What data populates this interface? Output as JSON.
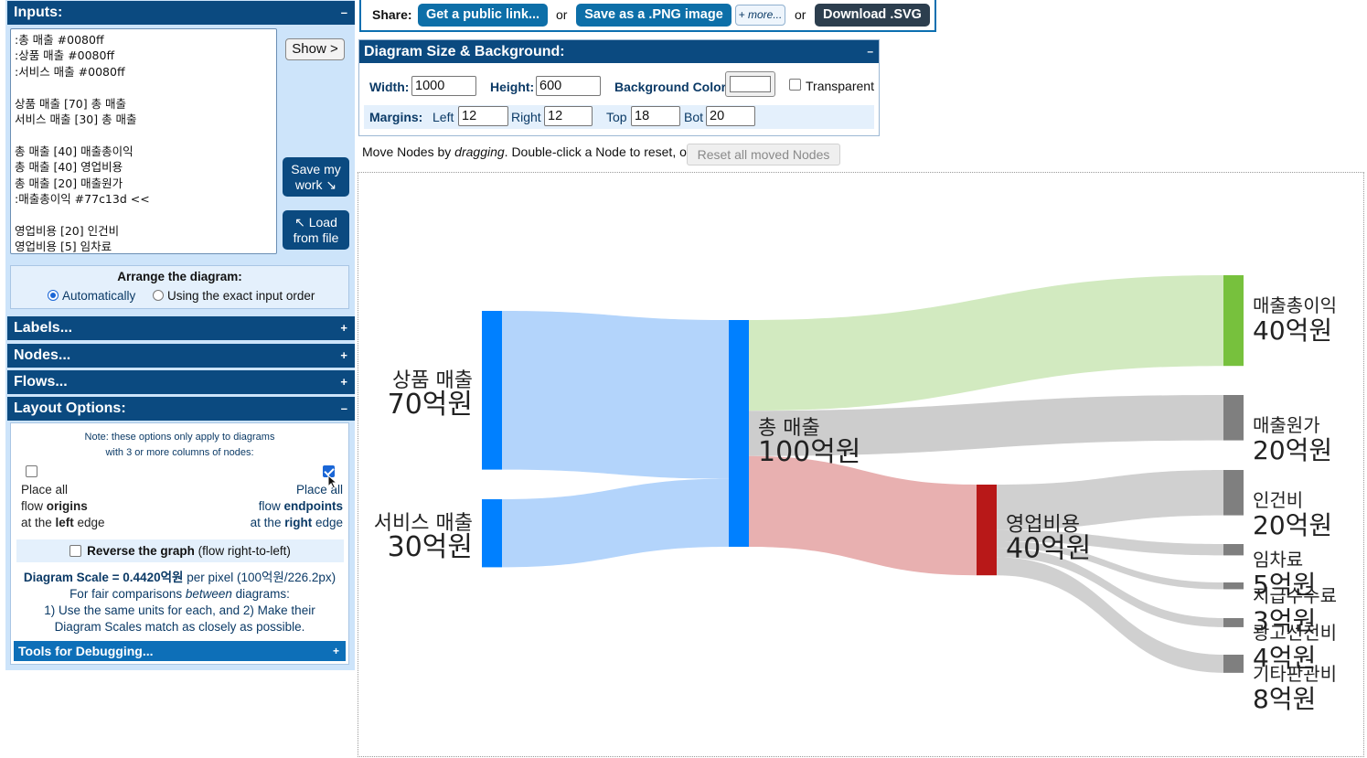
{
  "left_panel": {
    "inputs": {
      "title": "Inputs:",
      "toggle": "–",
      "text": ":총 매출 #0080ff\n:상품 매출 #0080ff\n:서비스 매출 #0080ff\n\n상품 매출 [70] 총 매출\n서비스 매출 [30] 총 매출\n\n총 매출 [40] 매출총이익\n총 매출 [40] 영업비용\n총 매출 [20] 매출원가\n:매출총이익 #77c13d <<\n\n영업비용 [20] 인건비\n영업비용 [5] 임차료",
      "show_label": "Show >",
      "save_label": "Save my work ↘",
      "load_label": "↖ Load from file"
    },
    "arrange": {
      "title": "Arrange the diagram:",
      "option_auto": "Automatically",
      "option_exact": "Using the exact input order",
      "selected": "Automatically"
    },
    "sections": [
      {
        "title": "Labels...",
        "toggle": "+"
      },
      {
        "title": "Nodes...",
        "toggle": "+"
      },
      {
        "title": "Flows...",
        "toggle": "+"
      }
    ],
    "layout_options": {
      "title": "Layout Options:",
      "toggle": "–",
      "note_line1": "Note: these options only apply to diagrams",
      "note_line2": "with 3 or more columns of nodes:",
      "left_opt": {
        "line1": "Place all",
        "line2a": "flow ",
        "line2b": "origins",
        "line3a": "at the ",
        "line3b": "left",
        "line3c": " edge",
        "checked": false
      },
      "right_opt": {
        "line1": "Place all",
        "line2a": "flow ",
        "line2b": "endpoints",
        "line3a": "at the ",
        "line3b": "right",
        "line3c": " edge",
        "checked": true
      },
      "reverse_bold": "Reverse the graph",
      "reverse_rest": " (flow right-to-left)",
      "scale_bold": "Diagram Scale = 0.4420억원",
      "scale_rest": " per pixel (100억원/226.2px)",
      "fair_line_a": "For fair comparisons ",
      "fair_line_em": "between",
      "fair_line_b": " diagrams:",
      "rule_line1": "1) Use the same units for each, and 2) Make their",
      "rule_line2": "Diagram Scales match as closely as possible.",
      "tools_title": "Tools for Debugging...",
      "tools_toggle": "+"
    }
  },
  "share": {
    "label": "Share:",
    "public_link": "Get a public link...",
    "or1": "or",
    "png": "Save as a .PNG image",
    "more": "+ more...",
    "or2": "or",
    "svg": "Download .SVG"
  },
  "size_panel": {
    "title": "Diagram Size & Background:",
    "toggle": "–",
    "width_label": "Width:",
    "width_value": "1000",
    "height_label": "Height:",
    "height_value": "600",
    "bg_label": "Background Color:",
    "bg_color": "#ffffff",
    "transparent_label": "Transparent",
    "margins_label": "Margins:",
    "left_label": "Left",
    "left_value": "12",
    "right_label": "Right",
    "right_value": "12",
    "top_label": "Top",
    "top_value": "18",
    "bot_label": "Bot",
    "bot_value": "20"
  },
  "move_bar": {
    "text_a": "Move Nodes by ",
    "text_em": "dragging",
    "text_b": ". Double-click a Node to reset, or:",
    "reset_label": "Reset all moved Nodes"
  },
  "colors": {
    "header_blue": "#0b4a80",
    "panel_bg": "#cde4fa",
    "share_teal": "#0d6fa8",
    "svg_dark": "#2c3e4e",
    "node_blue": "#0080ff",
    "node_green": "#77c13d",
    "node_red": "#b81818",
    "node_gray": "#7f7f7f"
  },
  "chart_data": {
    "type": "sankey",
    "units_suffix": "억원",
    "nodes": [
      {
        "id": "상품 매출",
        "name": "상품 매출",
        "value_label": "70억원",
        "value": 70,
        "color": "#0080ff"
      },
      {
        "id": "서비스 매출",
        "name": "서비스 매출",
        "value_label": "30억원",
        "value": 30,
        "color": "#0080ff"
      },
      {
        "id": "총 매출",
        "name": "총 매출",
        "value_label": "100억원",
        "value": 100,
        "color": "#0080ff"
      },
      {
        "id": "매출총이익",
        "name": "매출총이익",
        "value_label": "40억원",
        "value": 40,
        "color": "#77c13d"
      },
      {
        "id": "매출원가",
        "name": "매출원가",
        "value_label": "20억원",
        "value": 20,
        "color": "#7f7f7f"
      },
      {
        "id": "영업비용",
        "name": "영업비용",
        "value_label": "40억원",
        "value": 40,
        "color": "#b81818"
      },
      {
        "id": "인건비",
        "name": "인건비",
        "value_label": "20억원",
        "value": 20,
        "color": "#7f7f7f"
      },
      {
        "id": "임차료",
        "name": "임차료",
        "value_label": "5억원",
        "value": 5,
        "color": "#7f7f7f"
      },
      {
        "id": "지급수수료",
        "name": "지급수수료",
        "value_label": "3억원",
        "value": 3,
        "color": "#7f7f7f"
      },
      {
        "id": "광고선전비",
        "name": "광고선전비",
        "value_label": "4억원",
        "value": 4,
        "color": "#7f7f7f"
      },
      {
        "id": "기타판관비",
        "name": "기타판관비",
        "value_label": "8억원",
        "value": 8,
        "color": "#7f7f7f"
      }
    ],
    "flows": [
      {
        "source": "상품 매출",
        "target": "총 매출",
        "value": 70,
        "color": "#b3d4fb"
      },
      {
        "source": "서비스 매출",
        "target": "총 매출",
        "value": 30,
        "color": "#b3d4fb"
      },
      {
        "source": "총 매출",
        "target": "매출총이익",
        "value": 40,
        "color": "#d2eac0"
      },
      {
        "source": "총 매출",
        "target": "매출원가",
        "value": 20,
        "color": "#cdcdcd"
      },
      {
        "source": "총 매출",
        "target": "영업비용",
        "value": 40,
        "color": "#e8b0b0"
      },
      {
        "source": "영업비용",
        "target": "인건비",
        "value": 20,
        "color": "#d0d0d0"
      },
      {
        "source": "영업비용",
        "target": "임차료",
        "value": 5,
        "color": "#d0d0d0"
      },
      {
        "source": "영업비용",
        "target": "지급수수료",
        "value": 3,
        "color": "#d0d0d0"
      },
      {
        "source": "영업비용",
        "target": "광고선전비",
        "value": 4,
        "color": "#d0d0d0"
      },
      {
        "source": "영업비용",
        "target": "기타판관비",
        "value": 8,
        "color": "#d0d0d0"
      }
    ]
  }
}
